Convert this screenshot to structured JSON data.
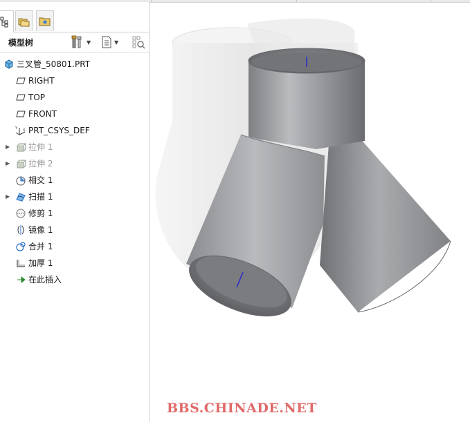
{
  "model_tree": {
    "title": "模型树",
    "items": [
      {
        "label": "三叉管_50801.PRT",
        "icon": "part-icon",
        "dim": false,
        "expandable": false
      },
      {
        "label": "RIGHT",
        "icon": "datum-plane-icon",
        "dim": false,
        "expandable": false
      },
      {
        "label": "TOP",
        "icon": "datum-plane-icon",
        "dim": false,
        "expandable": false
      },
      {
        "label": "FRONT",
        "icon": "datum-plane-icon",
        "dim": false,
        "expandable": false
      },
      {
        "label": "PRT_CSYS_DEF",
        "icon": "coordinate-system-icon",
        "dim": false,
        "expandable": false
      },
      {
        "label": "拉伸 1",
        "icon": "extrude-icon",
        "dim": true,
        "expandable": true
      },
      {
        "label": "拉伸 2",
        "icon": "extrude-icon",
        "dim": true,
        "expandable": true
      },
      {
        "label": "相交 1",
        "icon": "intersect-icon",
        "dim": false,
        "expandable": false
      },
      {
        "label": "扫描 1",
        "icon": "sweep-icon",
        "dim": false,
        "expandable": true
      },
      {
        "label": "修剪 1",
        "icon": "trim-icon",
        "dim": false,
        "expandable": false
      },
      {
        "label": "镜像 1",
        "icon": "mirror-icon",
        "dim": false,
        "expandable": false
      },
      {
        "label": "合并 1",
        "icon": "merge-icon",
        "dim": false,
        "expandable": false
      },
      {
        "label": "加厚 1",
        "icon": "thicken-icon",
        "dim": false,
        "expandable": false
      },
      {
        "label": "在此插入",
        "icon": "insert-here-arrow-icon",
        "dim": false,
        "expandable": false
      }
    ]
  },
  "tabs": [
    {
      "name": "model-tree-tab",
      "icon": "tree-icon",
      "active": true
    },
    {
      "name": "folder-browser-tab",
      "icon": "folders-icon",
      "active": false
    },
    {
      "name": "favorites-tab",
      "icon": "favorites-folder-icon",
      "active": false
    }
  ],
  "watermark": "BBS.CHINADE.NET",
  "colors": {
    "accent_blue": "#2a6fc9",
    "insert_arrow": "#2e8b2e",
    "watermark": "#e06a6a",
    "model_grey": "#9a9c9f"
  }
}
